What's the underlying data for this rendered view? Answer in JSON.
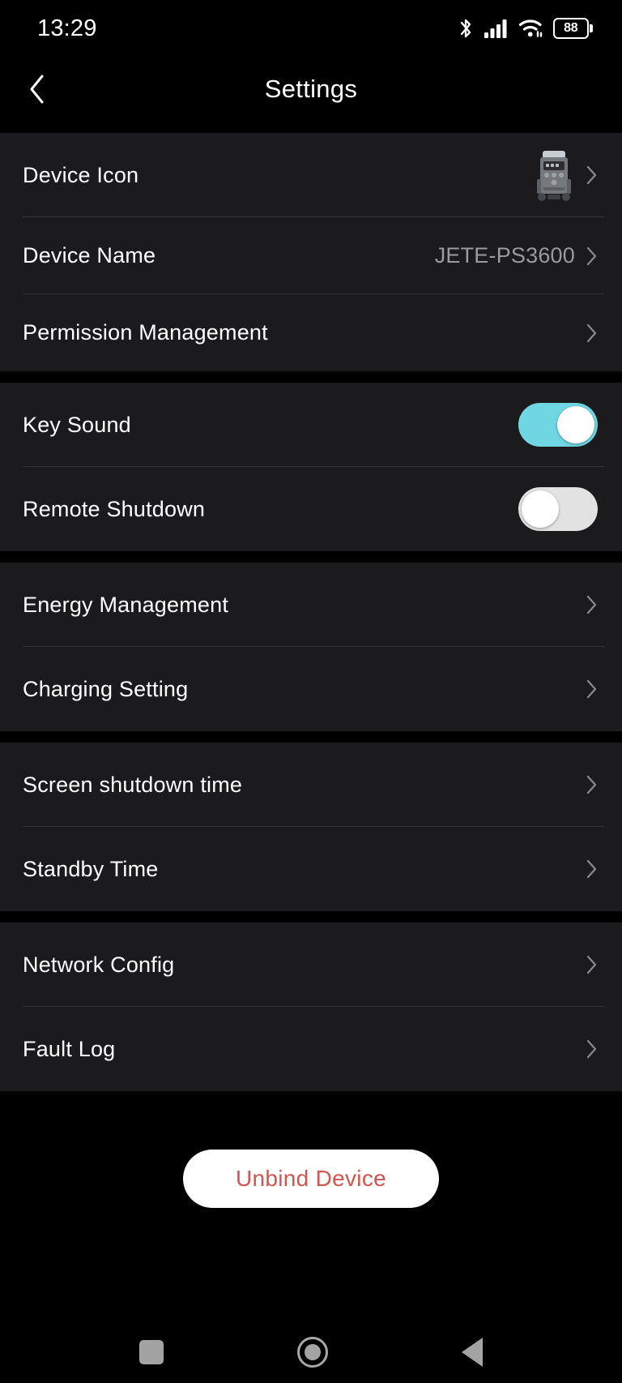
{
  "statusbar": {
    "time": "13:29",
    "bluetooth_icon": "bluetooth-icon",
    "signal_icon": "cellular-signal-icon",
    "wifi_icon": "wifi-icon",
    "battery_level": "88"
  },
  "header": {
    "title": "Settings",
    "back_icon": "back-chevron-icon"
  },
  "groups": [
    {
      "rows": [
        {
          "label": "Device Icon",
          "type": "thumbnail",
          "thumb": "power-station-icon",
          "chevron": true
        },
        {
          "label": "Device Name",
          "type": "value",
          "value": "JETE-PS3600",
          "chevron": true
        },
        {
          "label": "Permission Management",
          "type": "link",
          "chevron": true
        }
      ]
    },
    {
      "rows": [
        {
          "label": "Key Sound",
          "type": "toggle",
          "state": "on"
        },
        {
          "label": "Remote Shutdown",
          "type": "toggle",
          "state": "off"
        }
      ]
    },
    {
      "rows": [
        {
          "label": "Energy Management",
          "type": "link",
          "chevron": true
        },
        {
          "label": "Charging Setting",
          "type": "link",
          "chevron": true
        }
      ]
    },
    {
      "rows": [
        {
          "label": "Screen shutdown time",
          "type": "link",
          "chevron": true
        },
        {
          "label": "Standby Time",
          "type": "link",
          "chevron": true
        }
      ]
    },
    {
      "rows": [
        {
          "label": "Network Config",
          "type": "link",
          "chevron": true
        },
        {
          "label": "Fault Log",
          "type": "link",
          "chevron": true
        }
      ]
    }
  ],
  "unbind": {
    "label": "Unbind Device"
  },
  "navbar": {
    "recents_icon": "recents-square-icon",
    "home_icon": "home-circle-icon",
    "back_icon": "back-triangle-icon"
  },
  "colors": {
    "accent_toggle_on": "#6FD6E2",
    "toggle_off": "#E2E2E2",
    "unbind_text": "#D2564F",
    "card_bg": "#1B1B1D",
    "screen_bg": "#000000",
    "value_text": "#9B9B9E"
  }
}
